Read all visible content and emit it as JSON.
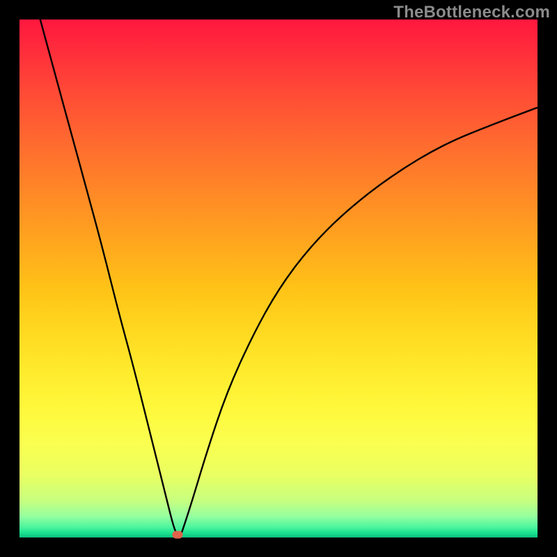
{
  "watermark": "TheBottleneck.com",
  "colors": {
    "frame": "#000000",
    "curve": "#000000",
    "marker": "#e0634b"
  },
  "chart_data": {
    "type": "line",
    "title": "",
    "xlabel": "",
    "ylabel": "",
    "xlim": [
      0,
      100
    ],
    "ylim": [
      0,
      100
    ],
    "grid": false,
    "legend": false,
    "description": "Bottleneck curve: V-shaped absolute-deviation curve. Left branch descends steeply from top-left to a minimum near x≈30; right branch rises concavely toward upper right. Minimum value ≈ 0.",
    "series": [
      {
        "name": "left-branch",
        "x": [
          4,
          7,
          10,
          13,
          16,
          19,
          22,
          25,
          28,
          30,
          31
        ],
        "values": [
          100,
          89,
          78,
          67,
          56,
          44,
          33,
          21,
          9,
          1,
          0
        ]
      },
      {
        "name": "right-branch",
        "x": [
          31,
          33,
          36,
          40,
          45,
          50,
          56,
          63,
          72,
          82,
          92,
          100
        ],
        "values": [
          0,
          6,
          16,
          28,
          39,
          48,
          56,
          63,
          70,
          76,
          80,
          83
        ]
      }
    ],
    "marker": {
      "x": 30.5,
      "y": 0.5
    }
  }
}
